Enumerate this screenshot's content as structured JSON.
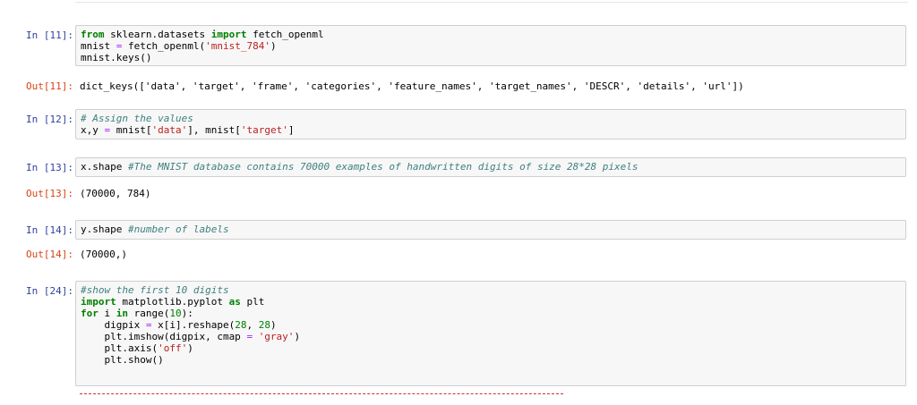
{
  "cells": [
    {
      "in_prompt": "In [11]:",
      "code": [
        [
          [
            "kw",
            "from"
          ],
          [
            "nm",
            " sklearn.datasets "
          ],
          [
            "kw",
            "import"
          ],
          [
            "nm",
            " fetch_openml"
          ]
        ],
        [
          [
            "nm",
            "mnist "
          ],
          [
            "op",
            "="
          ],
          [
            "nm",
            " fetch_openml("
          ],
          [
            "str",
            "'mnist_784'"
          ],
          [
            "nm",
            ")"
          ]
        ],
        [
          [
            "nm",
            "mnist.keys()"
          ]
        ]
      ],
      "out_prompt": "Out[11]:",
      "output": "dict_keys(['data', 'target', 'frame', 'categories', 'feature_names', 'target_names', 'DESCR', 'details', 'url'])"
    },
    {
      "in_prompt": "In [12]:",
      "code": [
        [
          [
            "com",
            "# Assign the values"
          ]
        ],
        [
          [
            "nm",
            "x,y "
          ],
          [
            "op",
            "="
          ],
          [
            "nm",
            " mnist["
          ],
          [
            "str",
            "'data'"
          ],
          [
            "nm",
            "], mnist["
          ],
          [
            "str",
            "'target'"
          ],
          [
            "nm",
            "]"
          ]
        ]
      ]
    },
    {
      "in_prompt": "In [13]:",
      "code": [
        [
          [
            "nm",
            "x.shape "
          ],
          [
            "com",
            "#The MNIST database contains 70000 examples of handwritten digits of size 28*28 pixels"
          ]
        ]
      ],
      "out_prompt": "Out[13]:",
      "output": "(70000, 784)"
    },
    {
      "in_prompt": "In [14]:",
      "code": [
        [
          [
            "nm",
            "y.shape "
          ],
          [
            "com",
            "#number of labels"
          ]
        ]
      ],
      "out_prompt": "Out[14]:",
      "output": "(70000,)"
    },
    {
      "in_prompt": "In [24]:",
      "code": [
        [
          [
            "com",
            "#show the first 10 digits"
          ]
        ],
        [
          [
            "kw",
            "import"
          ],
          [
            "nm",
            " matplotlib.pyplot "
          ],
          [
            "kw",
            "as"
          ],
          [
            "nm",
            " plt"
          ]
        ],
        [
          [
            "kw",
            "for"
          ],
          [
            "nm",
            " i "
          ],
          [
            "kw",
            "in"
          ],
          [
            "nm",
            " range("
          ],
          [
            "num",
            "10"
          ],
          [
            "nm",
            "):"
          ]
        ],
        [
          [
            "nm",
            "    digpix "
          ],
          [
            "op",
            "="
          ],
          [
            "nm",
            " x[i].reshape("
          ],
          [
            "num",
            "28"
          ],
          [
            "nm",
            ", "
          ],
          [
            "num",
            "28"
          ],
          [
            "nm",
            ")"
          ]
        ],
        [
          [
            "nm",
            "    plt.imshow(digpix, cmap "
          ],
          [
            "op",
            "="
          ],
          [
            "nm",
            " "
          ],
          [
            "str",
            "'gray'"
          ],
          [
            "nm",
            ")"
          ]
        ],
        [
          [
            "nm",
            "    plt.axis("
          ],
          [
            "str",
            "'off'"
          ],
          [
            "nm",
            ")"
          ]
        ],
        [
          [
            "nm",
            "    plt.show()"
          ]
        ]
      ]
    }
  ],
  "colors": {
    "in_prompt": "#303f9f",
    "out_prompt": "#d84315",
    "keyword": "#008000",
    "string": "#ba2121",
    "operator": "#aa22ff",
    "comment": "#408080",
    "error_line": "#d32f2f"
  }
}
